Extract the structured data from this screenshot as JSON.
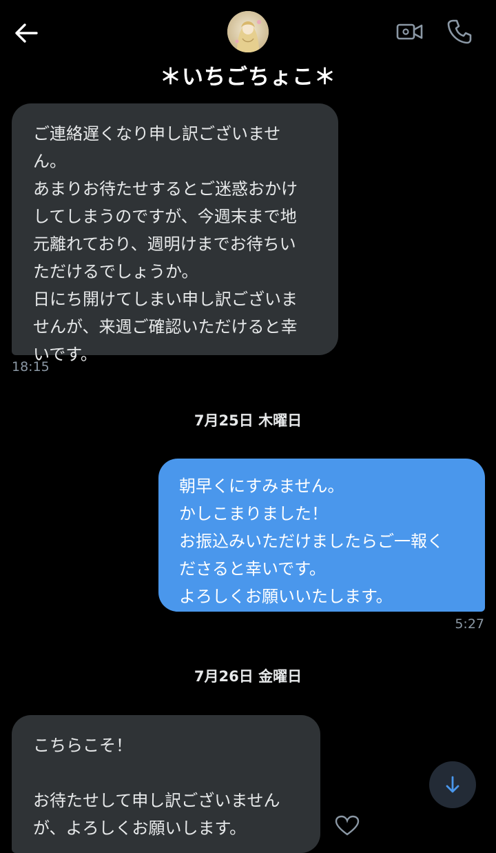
{
  "header": {
    "title": "＊いちごちょこ＊",
    "icons": [
      "back-arrow-icon",
      "avatar",
      "video-call-icon",
      "phone-icon"
    ]
  },
  "colors": {
    "background": "#000000",
    "incoming_bubble": "#2f3336",
    "outgoing_bubble": "#4a97ec",
    "timestamp": "#8b98a5",
    "scroll_button": "#232b36",
    "scroll_arrow": "#4a97ec"
  },
  "messages": [
    {
      "direction": "incoming",
      "text": "ご連絡遅くなり申し訳ございませ\nん。\nあまりお待たせするとご迷惑おかけ\nしてしまうのですが、今週末まで地\n元離れており、週明けまでお待ちい\nただけるでしょうか。\n日にち開けてしまい申し訳ございま\nせんが、来週ご確認いただけると幸\nいです。",
      "time": "18:15"
    },
    {
      "direction": "outgoing",
      "text": "朝早くにすみません。\nかしこまりました！\nお振込みいただけましたらご一報く\nださると幸いです。\nよろしくお願いいたします。",
      "time": "5:27"
    },
    {
      "direction": "incoming",
      "text": "こちらこそ！\n\nお待たせして申し訳ございません\nが、よろしくお願いします。"
    }
  ],
  "dates": [
    "7月25日 木曜日",
    "7月26日 金曜日"
  ],
  "controls": {
    "scroll_down_icon": "arrow-down-icon",
    "reaction_icon": "heart-icon"
  }
}
